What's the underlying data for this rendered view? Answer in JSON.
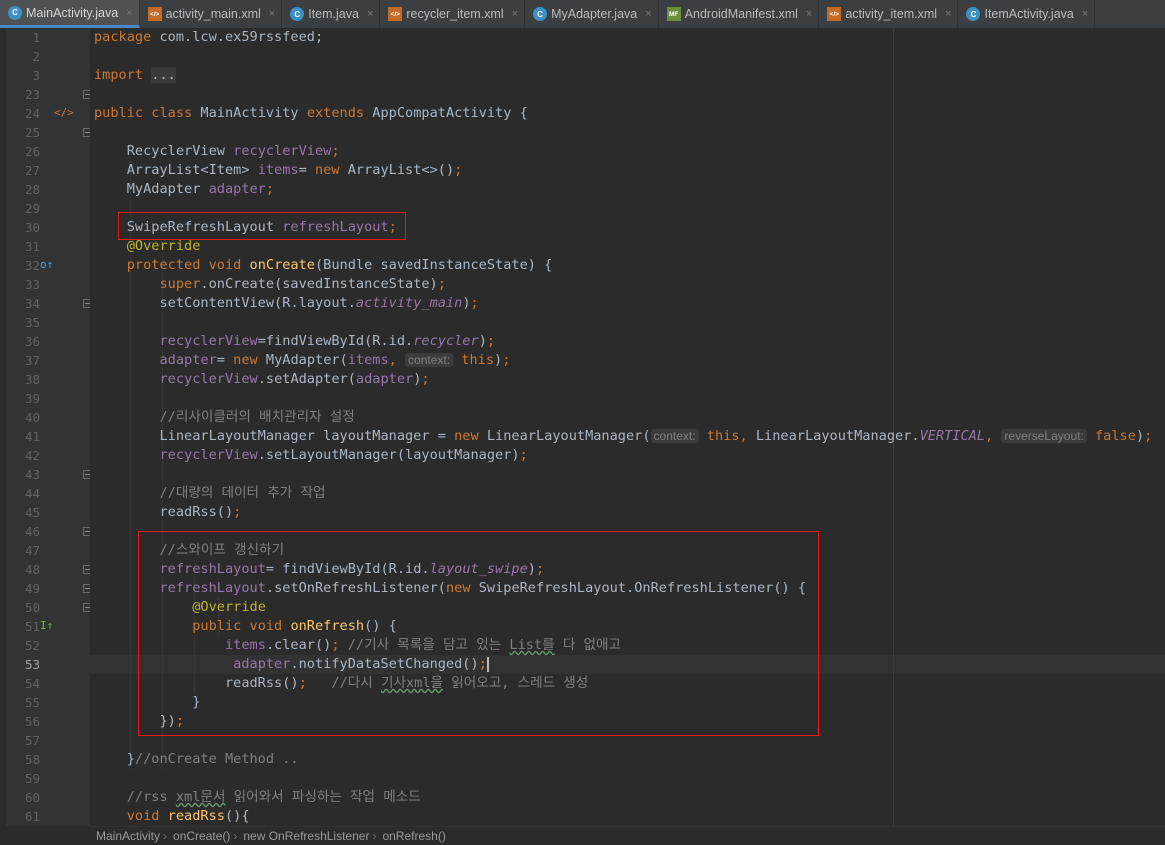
{
  "tabs": [
    {
      "label": "MainActivity.java",
      "icon": "java-class-icon",
      "active": true
    },
    {
      "label": "activity_main.xml",
      "icon": "xml-file-icon"
    },
    {
      "label": "Item.java",
      "icon": "java-class-icon"
    },
    {
      "label": "recycler_item.xml",
      "icon": "xml-file-icon"
    },
    {
      "label": "MyAdapter.java",
      "icon": "java-class-icon"
    },
    {
      "label": "AndroidManifest.xml",
      "icon": "manifest-file-icon"
    },
    {
      "label": "activity_item.xml",
      "icon": "xml-file-icon"
    },
    {
      "label": "ItemActivity.java",
      "icon": "java-class-icon"
    }
  ],
  "tab_close_glyph": "×",
  "current_line": "53",
  "lines": [
    {
      "n": "1",
      "parts": [
        [
          "kw",
          "package "
        ],
        [
          "",
          "com.lcw.ex59rssfeed;"
        ]
      ]
    },
    {
      "n": "2",
      "parts": []
    },
    {
      "n": "3",
      "parts": [
        [
          "kw",
          "import "
        ],
        [
          "fold-box",
          "..."
        ]
      ]
    },
    {
      "n": "23",
      "parts": []
    },
    {
      "n": "24",
      "parts": [
        [
          "kw",
          "public class "
        ],
        [
          "",
          "MainActivity "
        ],
        [
          "kw",
          "extends "
        ],
        [
          "",
          "AppCompatActivity {"
        ]
      ]
    },
    {
      "n": "25",
      "parts": []
    },
    {
      "n": "26",
      "parts": [
        [
          "",
          "    RecyclerView "
        ],
        [
          "fld",
          "recyclerView"
        ],
        [
          "kw",
          ";"
        ]
      ]
    },
    {
      "n": "27",
      "parts": [
        [
          "",
          "    ArrayList<Item> "
        ],
        [
          "fld",
          "items"
        ],
        [
          "",
          "= "
        ],
        [
          "kw",
          "new "
        ],
        [
          "",
          "ArrayList<>()"
        ],
        [
          "kw",
          ";"
        ]
      ]
    },
    {
      "n": "28",
      "parts": [
        [
          "",
          "    MyAdapter "
        ],
        [
          "fld",
          "adapter"
        ],
        [
          "kw",
          ";"
        ]
      ]
    },
    {
      "n": "29",
      "parts": []
    },
    {
      "n": "30",
      "parts": [
        [
          "",
          "    SwipeRefreshLayout "
        ],
        [
          "fld",
          "refreshLayout"
        ],
        [
          "kw",
          ";"
        ]
      ]
    },
    {
      "n": "31",
      "parts": [
        [
          "",
          "    "
        ],
        [
          "ann",
          "@Override"
        ]
      ]
    },
    {
      "n": "32",
      "parts": [
        [
          "",
          "    "
        ],
        [
          "kw",
          "protected void "
        ],
        [
          "fn",
          "onCreate"
        ],
        [
          "",
          "(Bundle savedInstanceState) {"
        ]
      ]
    },
    {
      "n": "33",
      "parts": [
        [
          "",
          "        "
        ],
        [
          "kw",
          "super"
        ],
        [
          "",
          ".onCreate(savedInstanceState)"
        ],
        [
          "kw",
          ";"
        ]
      ]
    },
    {
      "n": "34",
      "parts": [
        [
          "",
          "        setContentView(R.layout."
        ],
        [
          "ital",
          "activity_main"
        ],
        [
          "",
          ")"
        ],
        [
          "kw",
          ";"
        ]
      ]
    },
    {
      "n": "35",
      "parts": []
    },
    {
      "n": "36",
      "parts": [
        [
          "",
          "        "
        ],
        [
          "fld",
          "recyclerView"
        ],
        [
          "",
          "=findViewById(R.id."
        ],
        [
          "ital",
          "recycler"
        ],
        [
          "",
          ")"
        ],
        [
          "kw",
          ";"
        ]
      ]
    },
    {
      "n": "37",
      "parts": [
        [
          "",
          "        "
        ],
        [
          "fld",
          "adapter"
        ],
        [
          "",
          "= "
        ],
        [
          "kw",
          "new "
        ],
        [
          "",
          "MyAdapter("
        ],
        [
          "fld",
          "items"
        ],
        [
          "kw",
          ", "
        ],
        [
          "hint",
          "context:"
        ],
        [
          "kw",
          " this"
        ],
        [
          "",
          ")"
        ],
        [
          "kw",
          ";"
        ]
      ]
    },
    {
      "n": "38",
      "parts": [
        [
          "",
          "        "
        ],
        [
          "fld",
          "recyclerView"
        ],
        [
          "",
          ".setAdapter("
        ],
        [
          "fld",
          "adapter"
        ],
        [
          "",
          ")"
        ],
        [
          "kw",
          ";"
        ]
      ]
    },
    {
      "n": "39",
      "parts": []
    },
    {
      "n": "40",
      "parts": [
        [
          "cm",
          "        //리사이클러의 배치관리자 설정"
        ]
      ]
    },
    {
      "n": "41",
      "parts": [
        [
          "",
          "        LinearLayoutManager layoutManager = "
        ],
        [
          "kw",
          "new "
        ],
        [
          "",
          "LinearLayoutManager("
        ],
        [
          "hint",
          "context:"
        ],
        [
          "kw",
          " this, "
        ],
        [
          "",
          "LinearLayoutManager."
        ],
        [
          "ital",
          "VERTICAL"
        ],
        [
          "kw",
          ", "
        ],
        [
          "hint",
          "reverseLayout:"
        ],
        [
          "kw",
          " false"
        ],
        [
          "",
          ")"
        ],
        [
          "kw",
          ";"
        ]
      ]
    },
    {
      "n": "42",
      "parts": [
        [
          "",
          "        "
        ],
        [
          "fld",
          "recyclerView"
        ],
        [
          "",
          ".setLayoutManager(layoutManager)"
        ],
        [
          "kw",
          ";"
        ]
      ]
    },
    {
      "n": "43",
      "parts": []
    },
    {
      "n": "44",
      "parts": [
        [
          "cm",
          "        //대량의 데이터 추가 작업"
        ]
      ]
    },
    {
      "n": "45",
      "parts": [
        [
          "",
          "        readRss()"
        ],
        [
          "kw",
          ";"
        ]
      ]
    },
    {
      "n": "46",
      "parts": []
    },
    {
      "n": "47",
      "parts": [
        [
          "cm",
          "        //스와이프 갱신하기"
        ]
      ]
    },
    {
      "n": "48",
      "parts": [
        [
          "",
          "        "
        ],
        [
          "fld",
          "refreshLayout"
        ],
        [
          "",
          "= findViewById(R.id."
        ],
        [
          "ital",
          "layout_swipe"
        ],
        [
          "",
          ")"
        ],
        [
          "kw",
          ";"
        ]
      ]
    },
    {
      "n": "49",
      "parts": [
        [
          "",
          "        "
        ],
        [
          "fld",
          "refreshLayout"
        ],
        [
          "",
          ".setOnRefreshListener("
        ],
        [
          "kw",
          "new "
        ],
        [
          "",
          "SwipeRefreshLayout.OnRefreshListener() {"
        ]
      ]
    },
    {
      "n": "50",
      "parts": [
        [
          "",
          "            "
        ],
        [
          "ann",
          "@Override"
        ]
      ]
    },
    {
      "n": "51",
      "parts": [
        [
          "",
          "            "
        ],
        [
          "kw",
          "public void "
        ],
        [
          "fn",
          "onRefresh"
        ],
        [
          "",
          "() {"
        ]
      ]
    },
    {
      "n": "52",
      "parts": [
        [
          "",
          "                "
        ],
        [
          "fld",
          "items"
        ],
        [
          "",
          ".clear()"
        ],
        [
          "kw",
          "; "
        ],
        [
          "cm",
          "//기사 목록을 담고 있는 "
        ],
        [
          "cm typo",
          "List를"
        ],
        [
          "cm",
          " 다 없애고"
        ]
      ]
    },
    {
      "n": "53",
      "parts": [
        [
          "",
          "                 "
        ],
        [
          "fld",
          "adapter"
        ],
        [
          "",
          ".notifyDataSetChanged()"
        ],
        [
          "kw",
          ";"
        ],
        [
          "caret",
          ""
        ]
      ]
    },
    {
      "n": "54",
      "parts": [
        [
          "",
          "                readRss()"
        ],
        [
          "kw",
          ";   "
        ],
        [
          "cm",
          "//다시 "
        ],
        [
          "cm typo",
          "기사xml을"
        ],
        [
          "cm",
          " 읽어오고, 스레드 생성"
        ]
      ]
    },
    {
      "n": "55",
      "parts": [
        [
          "",
          "            }"
        ]
      ]
    },
    {
      "n": "56",
      "parts": [
        [
          "",
          "        })"
        ],
        [
          "kw",
          ";"
        ]
      ]
    },
    {
      "n": "57",
      "parts": []
    },
    {
      "n": "58",
      "parts": [
        [
          "",
          "    }"
        ],
        [
          "cm",
          "//onCreate Method .."
        ]
      ]
    },
    {
      "n": "59",
      "parts": []
    },
    {
      "n": "60",
      "parts": [
        [
          "cm",
          "    //rss "
        ],
        [
          "cm typo",
          "xml문서"
        ],
        [
          "cm",
          " 읽어와서 파싱하는 작업 메소드"
        ]
      ]
    },
    {
      "n": "61",
      "parts": [
        [
          "",
          "    "
        ],
        [
          "kw",
          "void "
        ],
        [
          "fn",
          "readRss"
        ],
        [
          "",
          "(){"
        ]
      ]
    }
  ],
  "breadcrumb": [
    "MainActivity",
    "onCreate()",
    "new OnRefreshListener",
    "onRefresh()"
  ],
  "breadcrumb_sep": "›",
  "gutter_icons": [
    {
      "line": "24",
      "name": "class-layout-icon",
      "glyph": "</>"
    },
    {
      "line": "32",
      "name": "override-method-icon",
      "glyph": "o↑"
    },
    {
      "line": "51",
      "name": "implement-method-icon",
      "glyph": "I↑"
    }
  ],
  "colors": {
    "highlight_box": "#e81616",
    "keyword": "#cc7832",
    "field": "#9876aa",
    "method": "#ffc66d",
    "annotation": "#bbb529",
    "comment": "#808080"
  }
}
